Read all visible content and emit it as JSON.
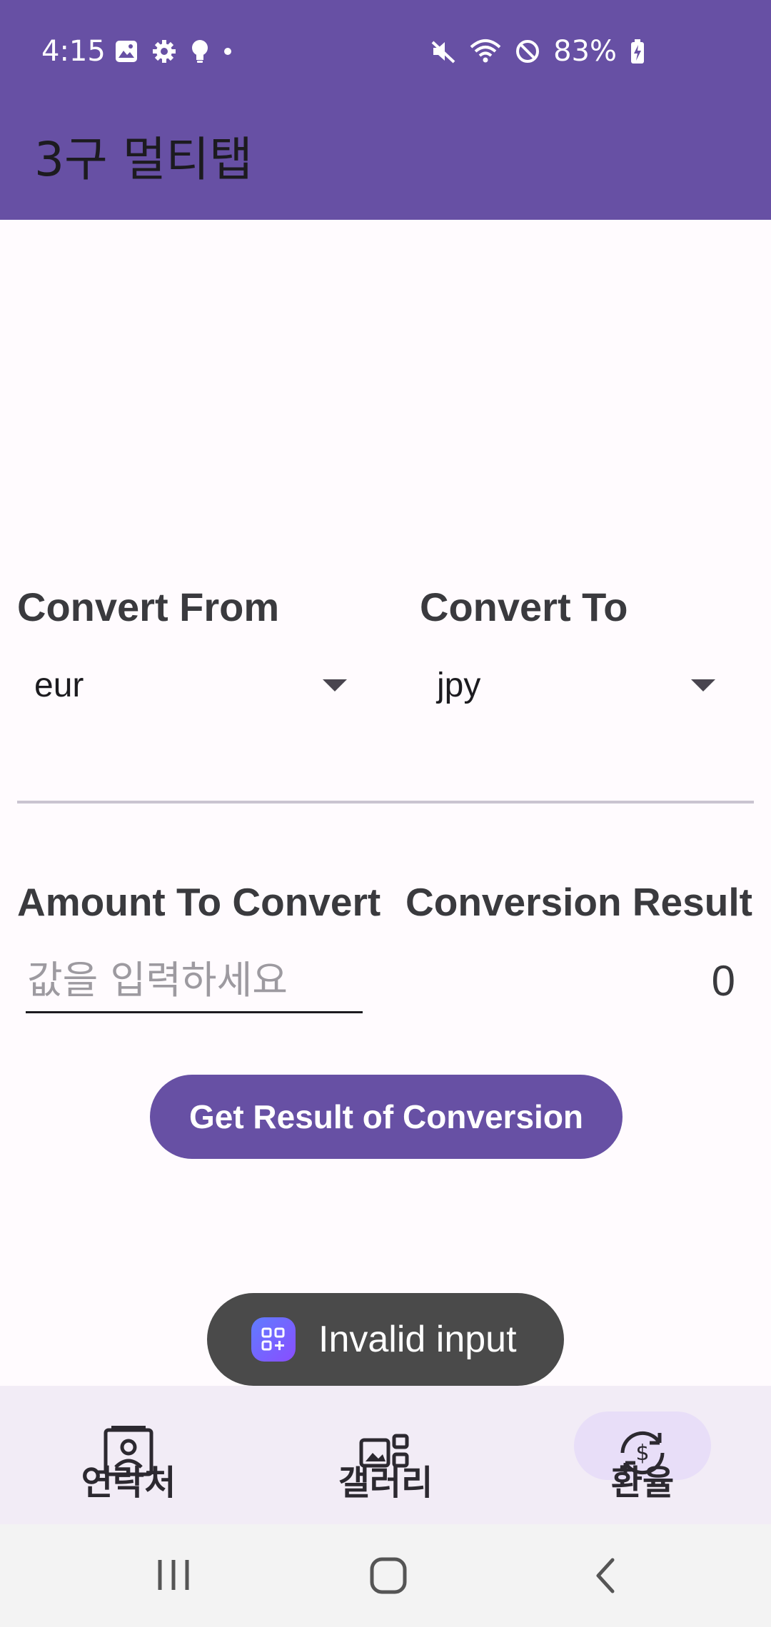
{
  "status_bar": {
    "time": "4:15",
    "battery": "83%",
    "left_icons": [
      "image-icon",
      "gear-icon",
      "lightbulb-icon",
      "dot-icon"
    ],
    "right_icons": [
      "mute-icon",
      "wifi-icon",
      "do-not-disturb-icon",
      "battery-charging-icon"
    ]
  },
  "app_bar": {
    "title": "3구 멀티탭"
  },
  "converter": {
    "from_label": "Convert From",
    "to_label": "Convert To",
    "from_value": "eur",
    "to_value": "jpy",
    "amount_label": "Amount To Convert",
    "result_label": "Conversion Result",
    "amount_placeholder": "값을 입력하세요",
    "amount_value": "",
    "result_value": "0",
    "button_label": "Get Result of Conversion"
  },
  "toast": {
    "text": "Invalid input",
    "icon": "app-grid-icon"
  },
  "bottom_nav": {
    "items": [
      {
        "label": "연락처",
        "icon": "contact-card-icon",
        "selected": false
      },
      {
        "label": "갤러리",
        "icon": "gallery-icon",
        "selected": false
      },
      {
        "label": "환율",
        "icon": "currency-exchange-icon",
        "selected": true
      }
    ]
  },
  "system_nav": {
    "icons": [
      "recents-icon",
      "home-icon",
      "back-icon"
    ]
  },
  "colors": {
    "primary": "#6750a4",
    "surface": "#fffbfe",
    "nav_bg": "#f2ecf6",
    "indicator": "#e8def8"
  }
}
